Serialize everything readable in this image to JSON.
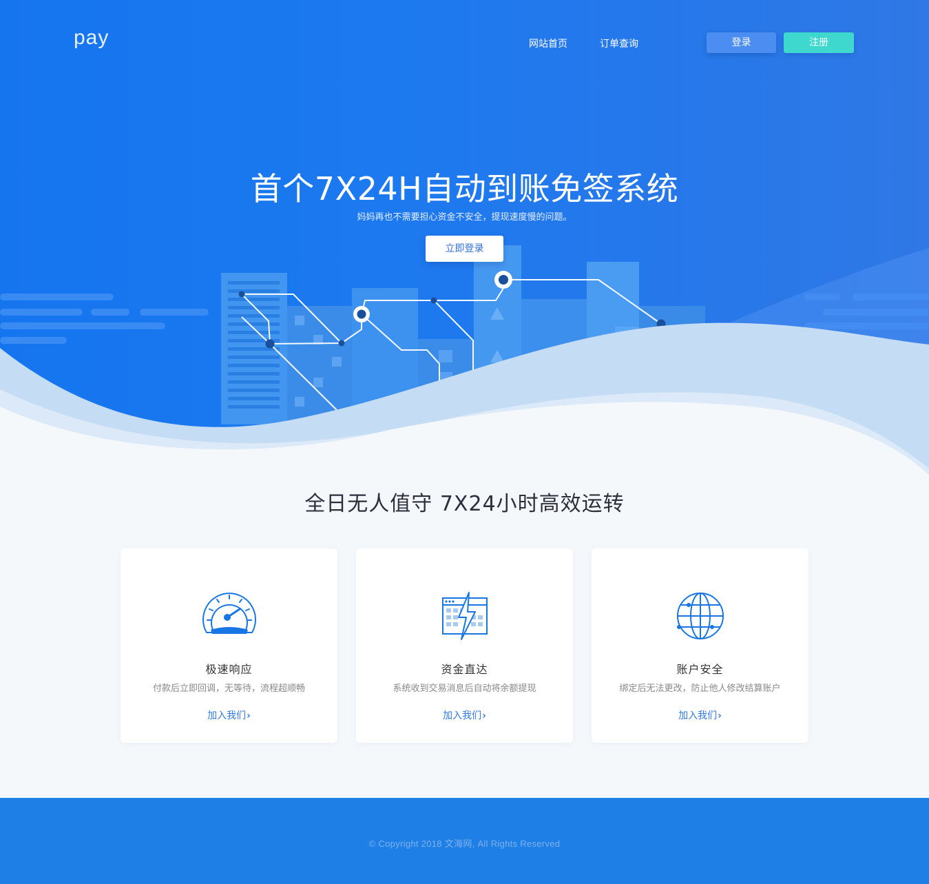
{
  "header": {
    "logo": "pay",
    "nav": [
      {
        "label": "网站首页"
      },
      {
        "label": "订单查询"
      }
    ],
    "login_label": "登录",
    "register_label": "注册"
  },
  "hero": {
    "title": "首个7X24H自动到账免签系统",
    "subtitle": "妈妈再也不需要担心资金不安全，提现速度慢的问题。",
    "cta_label": "立即登录"
  },
  "features": {
    "title": "全日无人值守 7X24小时高效运转",
    "cards": [
      {
        "icon": "speedometer-icon",
        "title": "极速响应",
        "desc": "付款后立即回调，无等待，流程超顺畅",
        "link": "加入我们"
      },
      {
        "icon": "lightning-window-icon",
        "title": "资金直达",
        "desc": "系统收到交易消息后自动将余额提现",
        "link": "加入我们"
      },
      {
        "icon": "globe-icon",
        "title": "账户安全",
        "desc": "绑定后无法更改，防止他人修改结算账户",
        "link": "加入我们"
      }
    ]
  },
  "footer": {
    "copyright": "© Copyright 2018 文海网, All Rights Reserved"
  },
  "colors": {
    "hero_blue": "#1575ef",
    "register_teal": "#3ed8cf",
    "link_blue": "#2f7ae4",
    "footer_blue": "#1e7fe6"
  }
}
